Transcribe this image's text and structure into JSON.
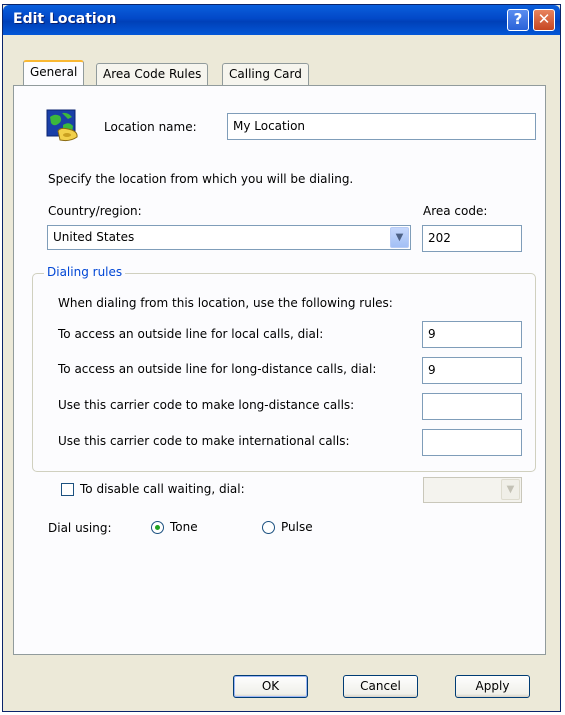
{
  "window": {
    "title": "Edit Location",
    "help_glyph": "?",
    "close_glyph": "✕"
  },
  "tabs": [
    {
      "label": "General",
      "active": true
    },
    {
      "label": "Area Code Rules",
      "active": false
    },
    {
      "label": "Calling Card",
      "active": false
    }
  ],
  "general": {
    "location_name_label": "Location name:",
    "location_name_value": "My Location",
    "specify_text": "Specify the location from which you will be dialing.",
    "country_label": "Country/region:",
    "country_value": "United States",
    "area_code_label": "Area code:",
    "area_code_value": "202"
  },
  "dialing_rules": {
    "title": "Dialing rules",
    "intro": "When dialing from this location, use the following rules:",
    "local_label": "To access an outside line for local calls, dial:",
    "local_value": "9",
    "long_distance_label": "To access an outside line for long-distance calls, dial:",
    "long_distance_value": "9",
    "carrier_long_label": "Use this carrier code to make long-distance calls:",
    "carrier_long_value": "",
    "carrier_intl_label": "Use this carrier code to make international calls:",
    "carrier_intl_value": ""
  },
  "call_waiting": {
    "label": "To disable call waiting, dial:",
    "checked": false,
    "value": ""
  },
  "dial_using": {
    "label": "Dial using:",
    "tone_label": "Tone",
    "pulse_label": "Pulse",
    "selected": "Tone"
  },
  "buttons": {
    "ok": "OK",
    "cancel": "Cancel",
    "apply": "Apply"
  },
  "icons": {
    "location": "globe-phone-icon",
    "dropdown": "chevron-down-icon"
  }
}
